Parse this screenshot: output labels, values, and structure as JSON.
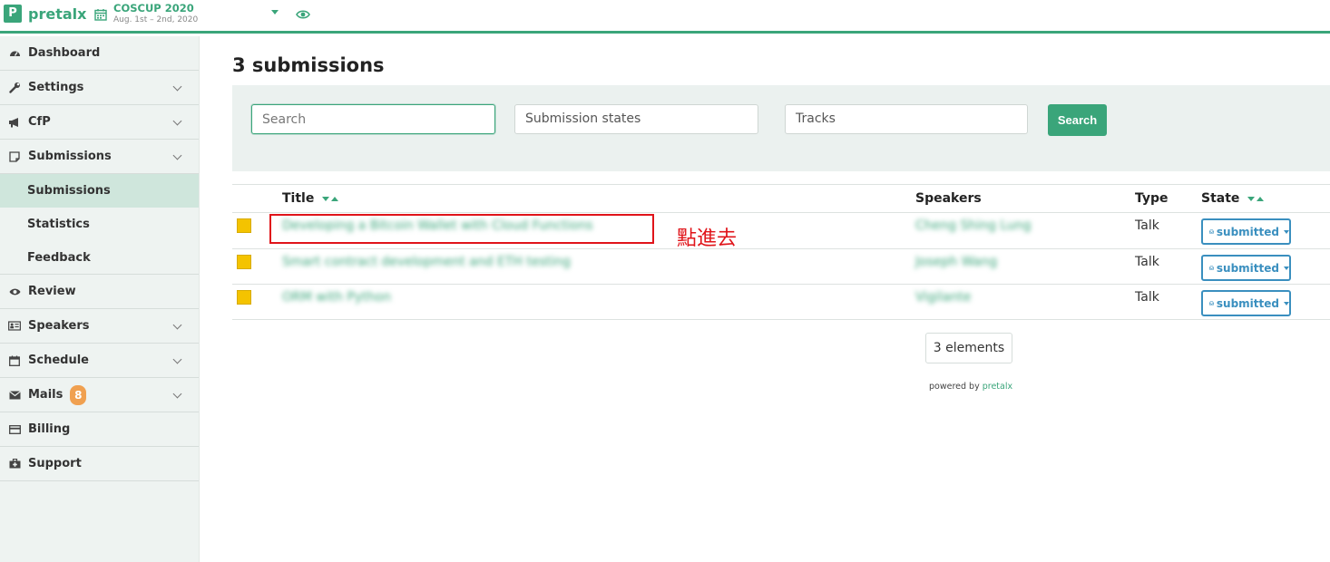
{
  "header": {
    "logo_letter": "P",
    "brand": "pretalx",
    "event_name": "COSCUP 2020",
    "event_dates": "Aug. 1st – 2nd, 2020"
  },
  "sidebar": {
    "items": [
      {
        "label": "Dashboard",
        "icon": "dashboard-icon"
      },
      {
        "label": "Settings",
        "icon": "wrench-icon"
      },
      {
        "label": "CfP",
        "icon": "bullhorn-icon"
      },
      {
        "label": "Submissions",
        "icon": "sticky-note-icon"
      },
      {
        "label": "Review",
        "icon": "eye-icon"
      },
      {
        "label": "Speakers",
        "icon": "id-card-icon"
      },
      {
        "label": "Schedule",
        "icon": "calendar-icon"
      },
      {
        "label": "Mails",
        "icon": "envelope-icon"
      },
      {
        "label": "Billing",
        "icon": "credit-card-icon"
      },
      {
        "label": "Support",
        "icon": "medkit-icon"
      }
    ],
    "submissions_sub": [
      "Submissions",
      "Statistics",
      "Feedback"
    ],
    "mails_badge": "8"
  },
  "main": {
    "title": "3 submissions",
    "filters": {
      "search_placeholder": "Search",
      "states": "Submission states",
      "tracks": "Tracks",
      "search_button": "Search"
    },
    "columns": {
      "title": "Title",
      "speakers": "Speakers",
      "type": "Type",
      "state": "State"
    },
    "rows": [
      {
        "title": "Developing a Bitcoin Wallet with Cloud Functions",
        "speakers": "Cheng Shing Lung",
        "type": "Talk",
        "state": "submitted",
        "color": "#f4c300"
      },
      {
        "title": "Smart contract development and ETH testing",
        "speakers": "Joseph Wang",
        "type": "Talk",
        "state": "submitted",
        "color": "#f4c300"
      },
      {
        "title": "ORM with Python",
        "speakers": "Vigilante",
        "type": "Talk",
        "state": "submitted",
        "color": "#f4c300"
      }
    ],
    "annotation": "點進去",
    "element_count": "3 elements",
    "footer_prefix": "powered by",
    "footer_brand": "pretalx"
  },
  "colors": {
    "accent": "#3aa57a",
    "state": "#3a8fbf",
    "annotation": "#e0141a",
    "badge": "#f0a050"
  }
}
